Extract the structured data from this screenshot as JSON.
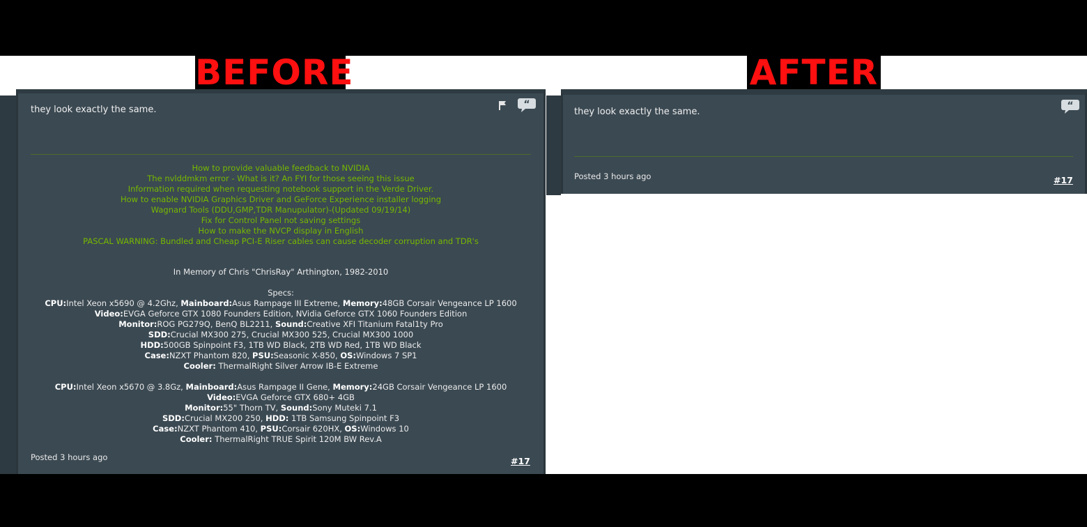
{
  "headings": {
    "before": "BEFORE",
    "after": "AFTER"
  },
  "before": {
    "post_text": "they look exactly the same.",
    "icons": [
      "flag-icon",
      "quote-icon"
    ],
    "links": [
      "How to provide valuable feedback to NVIDIA",
      "The nvlddmkm error - What is it? An FYI for those seeing this issue",
      "Information required when requesting notebook support in the Verde Driver.",
      "How to enable NVIDIA Graphics Driver and GeForce Experience installer logging",
      "Wagnard Tools (DDU,GMP,TDR Manupulator)-(Updated 09/19/14)",
      "Fix for Control Panel not saving settings",
      "How to make the NVCP display in English",
      "PASCAL WARNING: Bundled and Cheap PCI-E Riser cables can cause decoder corruption and TDR's"
    ],
    "memory_line": "In Memory of Chris \"ChrisRay\" Arthington, 1982-2010",
    "specs_title": "Specs:",
    "rig1": [
      [
        [
          "CPU:",
          "Intel Xeon x5690 @ 4.2Ghz, "
        ],
        [
          "Mainboard:",
          "Asus Rampage III Extreme, "
        ],
        [
          "Memory:",
          "48GB Corsair Vengeance LP 1600"
        ]
      ],
      [
        [
          "Video:",
          "EVGA Geforce GTX 1080 Founders Edition, NVidia Geforce GTX 1060 Founders Edition"
        ]
      ],
      [
        [
          "Monitor:",
          "ROG PG279Q, BenQ BL2211, "
        ],
        [
          "Sound:",
          "Creative XFI Titanium Fatal1ty Pro"
        ]
      ],
      [
        [
          "SDD:",
          "Crucial MX300 275, Crucial MX300 525, Crucial MX300 1000"
        ]
      ],
      [
        [
          "HDD:",
          "500GB Spinpoint F3, 1TB WD Black, 2TB WD Red, 1TB WD Black"
        ]
      ],
      [
        [
          "Case:",
          "NZXT Phantom 820, "
        ],
        [
          "PSU:",
          "Seasonic X-850, "
        ],
        [
          "OS:",
          "Windows 7 SP1"
        ]
      ],
      [
        [
          "Cooler:",
          " ThermalRight Silver Arrow IB-E Extreme"
        ]
      ]
    ],
    "rig2": [
      [
        [
          "CPU:",
          "Intel Xeon x5670 @ 3.8Gz, "
        ],
        [
          "Mainboard:",
          "Asus Rampage II Gene, "
        ],
        [
          "Memory:",
          "24GB Corsair Vengeance LP 1600"
        ]
      ],
      [
        [
          "Video:",
          "EVGA Geforce GTX 680+ 4GB"
        ]
      ],
      [
        [
          "Monitor:",
          "55\" Thorn TV, "
        ],
        [
          "Sound:",
          "Sony Muteki 7.1"
        ]
      ],
      [
        [
          "SDD:",
          "Crucial MX200 250, "
        ],
        [
          "HDD:",
          " 1TB Samsung Spinpoint F3"
        ]
      ],
      [
        [
          "Case:",
          "NZXT Phantom 410, "
        ],
        [
          "PSU:",
          "Corsair 620HX, "
        ],
        [
          "OS:",
          "Windows 10"
        ]
      ],
      [
        [
          "Cooler:",
          " ThermalRight TRUE Spirit 120M BW Rev.A"
        ]
      ]
    ],
    "posted": "Posted 3 hours ago",
    "post_number": "#17"
  },
  "after": {
    "post_text": "they look exactly the same.",
    "icons": [
      "quote-icon"
    ],
    "posted": "Posted 3 hours ago",
    "post_number": "#17"
  }
}
